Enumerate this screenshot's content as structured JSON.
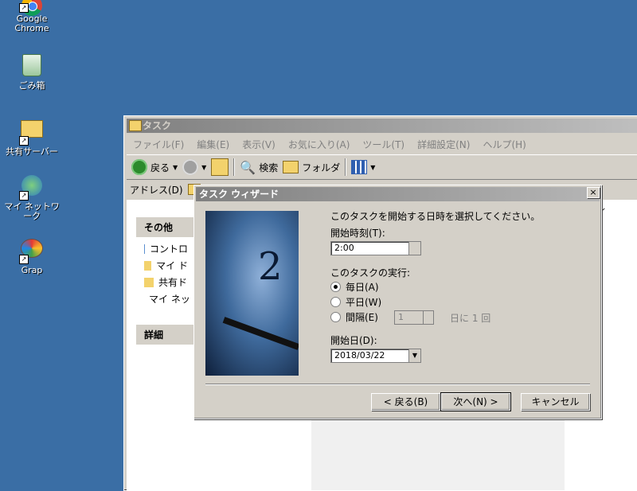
{
  "desktop": {
    "icons": [
      {
        "label": "Google\nChrome",
        "icon": "chrome-icon"
      },
      {
        "label": "ごみ箱",
        "icon": "recycle-bin-icon"
      },
      {
        "label": "共有サーバー",
        "icon": "shared-folder-icon"
      },
      {
        "label": "マイ ネットワーク",
        "icon": "network-icon"
      },
      {
        "label": "Grap",
        "icon": "paint-icon"
      }
    ]
  },
  "explorer": {
    "title": "タスク",
    "menu": [
      "ファイル(F)",
      "編集(E)",
      "表示(V)",
      "お気に入り(A)",
      "ツール(T)",
      "詳細設定(N)",
      "ヘルプ(H)"
    ],
    "toolbar": {
      "back": "戻る",
      "search": "検索",
      "folder": "フォルダ"
    },
    "address_label": "アドレス(D)",
    "side": {
      "other_title": "その他",
      "other_items": [
        "コントロ",
        "マイ ド",
        "共有ド",
        "マイ ネッ"
      ],
      "details_title": "詳細"
    },
    "list_header_frag": "ル"
  },
  "wizard": {
    "title": "タスク ウィザード",
    "close": "×",
    "prompt": "このタスクを開始する日時を選択してください。",
    "start_time_label": "開始時刻(T):",
    "start_time_value": "2:00",
    "run_label": "このタスクの実行:",
    "options": [
      {
        "label": "毎日(A)",
        "selected": true
      },
      {
        "label": "平日(W)",
        "selected": false
      },
      {
        "label": "間隔(E)",
        "selected": false
      }
    ],
    "interval_value": "1",
    "interval_text": "日に 1 回",
    "start_date_label": "開始日(D):",
    "start_date_value": "2018/03/22",
    "buttons": {
      "back": "< 戻る(B)",
      "next": "次へ(N) >",
      "cancel": "キャンセル"
    }
  },
  "colors": {
    "desktop_bg": "#3a6ea5",
    "dialog_bg": "#d4d0c8"
  }
}
